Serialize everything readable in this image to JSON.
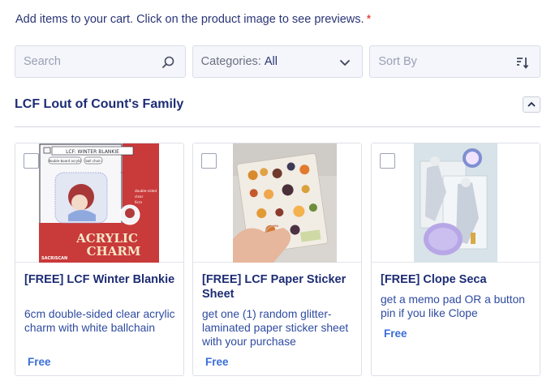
{
  "instruction": {
    "text": "Add items to your cart. Click on the product image to see previews.",
    "required_mark": "*"
  },
  "filters": {
    "search_placeholder": "Search",
    "categories_label": "Categories:",
    "categories_value": "All",
    "sort_label": "Sort By"
  },
  "section": {
    "title": "LCF Lout of Count's Family"
  },
  "products": [
    {
      "name": "[FREE] LCF Winter Blankie",
      "description": "6cm double-sided clear acrylic charm with white ballchain",
      "price": "Free",
      "image_text": {
        "header": "LCF: WINTER BLANKIE",
        "tag1": "double-board acrylic",
        "tag2": "ball chain",
        "size1": "double-sided",
        "size2": "clear",
        "size3": "6cm",
        "title_line1": "ACRYLIC",
        "title_line2": "CHARM",
        "brand": "SACRISCAN"
      }
    },
    {
      "name": "[FREE] LCF Paper Sticker Sheet",
      "description": "get one (1) random glitter-laminated paper sticker sheet with your purchase",
      "price": "Free"
    },
    {
      "name": "[FREE] Clope Seca",
      "description": "get a memo pad OR a button pin if you like Clope",
      "price": "Free"
    }
  ],
  "colors": {
    "heading": "#1d2c74",
    "description": "#2e4ba0",
    "price": "#3a6ed8",
    "required": "#e02424",
    "acrylic_red": "#c93a3a"
  }
}
